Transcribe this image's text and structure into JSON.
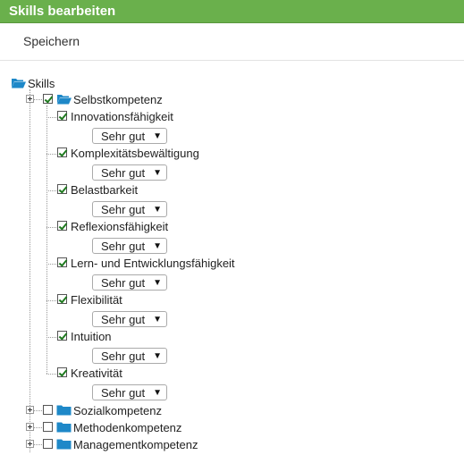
{
  "header": {
    "title": "Skills bearbeiten"
  },
  "toolbar": {
    "save_label": "Speichern"
  },
  "tree": {
    "root_label": "Skills",
    "categories": [
      {
        "label": "Selbstkompetenz",
        "checked": true,
        "expanded": true,
        "skills": [
          {
            "label": "Innovationsfähigkeit",
            "checked": true,
            "level": "Sehr gut"
          },
          {
            "label": "Komplexitätsbewältigung",
            "checked": true,
            "level": "Sehr gut"
          },
          {
            "label": "Belastbarkeit",
            "checked": true,
            "level": "Sehr gut"
          },
          {
            "label": "Reflexionsfähigkeit",
            "checked": true,
            "level": "Sehr gut"
          },
          {
            "label": "Lern- und Entwicklungsfähigkeit",
            "checked": true,
            "level": "Sehr gut"
          },
          {
            "label": "Flexibilität",
            "checked": true,
            "level": "Sehr gut"
          },
          {
            "label": "Intuition",
            "checked": true,
            "level": "Sehr gut"
          },
          {
            "label": "Kreativität",
            "checked": true,
            "level": "Sehr gut"
          }
        ]
      },
      {
        "label": "Sozialkompetenz",
        "checked": false,
        "expanded": false
      },
      {
        "label": "Methodenkompetenz",
        "checked": false,
        "expanded": false
      },
      {
        "label": "Managementkompetenz",
        "checked": false,
        "expanded": false
      }
    ]
  },
  "colors": {
    "header_bg": "#6ab04c",
    "folder": "#1e88c8",
    "check": "#1f7a1f"
  },
  "icons": {
    "open_folder": "folder-open-icon",
    "closed_folder": "folder-icon",
    "expander": "expand-plus-icon",
    "dropdown": "dropdown-arrow-icon"
  }
}
